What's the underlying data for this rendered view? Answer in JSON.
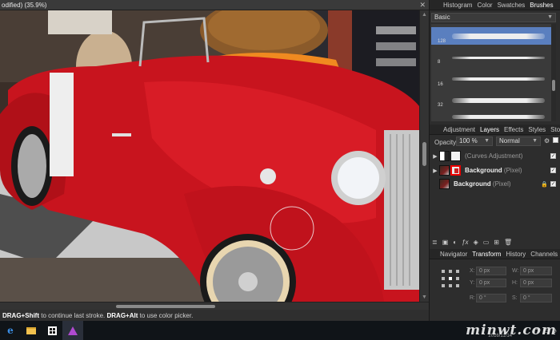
{
  "document": {
    "title": "odified) (35.9%)",
    "close_glyph": "✕"
  },
  "canvas": {
    "photo_stamp": "2016/11/14"
  },
  "status_bar": {
    "part1_bold": "DRAG+Shift",
    "part1_rest": " to continue last stroke. ",
    "part2_bold": "DRAG+Alt",
    "part2_rest": " to use color picker."
  },
  "top_panel": {
    "tabs": [
      "Histogram",
      "Color",
      "Swatches",
      "Brushes"
    ],
    "active_tab": "Brushes",
    "category_dropdown": "Basic",
    "brush_sizes": [
      "128",
      "8",
      "16",
      "32"
    ]
  },
  "layers_panel": {
    "tabs": [
      "Adjustment",
      "Layers",
      "Effects",
      "Styles",
      "Stock"
    ],
    "active_tab": "Layers",
    "opacity_label": "Opacity:",
    "opacity_value": "100 %",
    "blend_mode": "Normal",
    "layers": [
      {
        "name": "",
        "type": "(Curves Adjustment)",
        "expandable": true
      },
      {
        "name": "Background",
        "type": "(Pixel)",
        "expandable": true
      },
      {
        "name": "Background",
        "type": "(Pixel)",
        "expandable": false,
        "locked": true
      }
    ]
  },
  "transform_panel": {
    "tabs": [
      "Navigator",
      "Transform",
      "History",
      "Channels"
    ],
    "active_tab": "Transform",
    "fields": {
      "x_label": "X:",
      "x_value": "0 px",
      "w_label": "W:",
      "w_value": "0 px",
      "y_label": "Y:",
      "y_value": "0 px",
      "h_label": "H:",
      "h_value": "0 px",
      "r_label": "R:",
      "r_value": "0 °",
      "s_label": "S:",
      "s_value": "0 °"
    }
  },
  "taskbar": {
    "icons": [
      "edge-browser-icon",
      "file-explorer-icon",
      "store-icon",
      "affinity-photo-icon"
    ]
  },
  "watermark": "minwt.com",
  "colors": {
    "accent": "#5a7fbf",
    "panel_bg": "#2d2d2d",
    "taskbar_bg": "#101418",
    "mask_highlight": "#e00000"
  }
}
